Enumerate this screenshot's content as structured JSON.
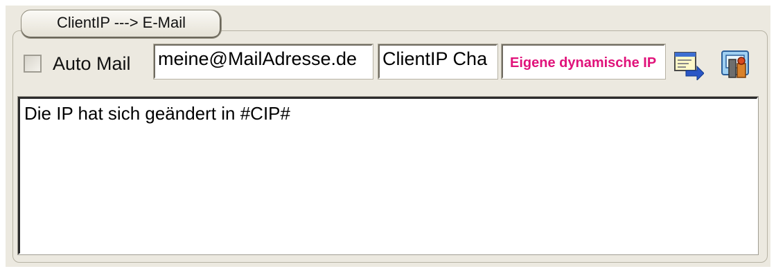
{
  "group": {
    "title": "ClientIP ---> E-Mail"
  },
  "auto_mail": {
    "label": "Auto Mail",
    "checked": false
  },
  "fields": {
    "email": "meine@MailAdresse.de",
    "subject": "ClientIP Cha",
    "ip": "Eigene dynamische IP"
  },
  "icons": {
    "send_mail": "mail-send-icon",
    "settings": "settings-icon"
  },
  "message": {
    "text": "Die IP hat sich geändert in #CIP#"
  },
  "colors": {
    "panel_bg": "#ece9e0",
    "ip_text": "#e0127a"
  }
}
